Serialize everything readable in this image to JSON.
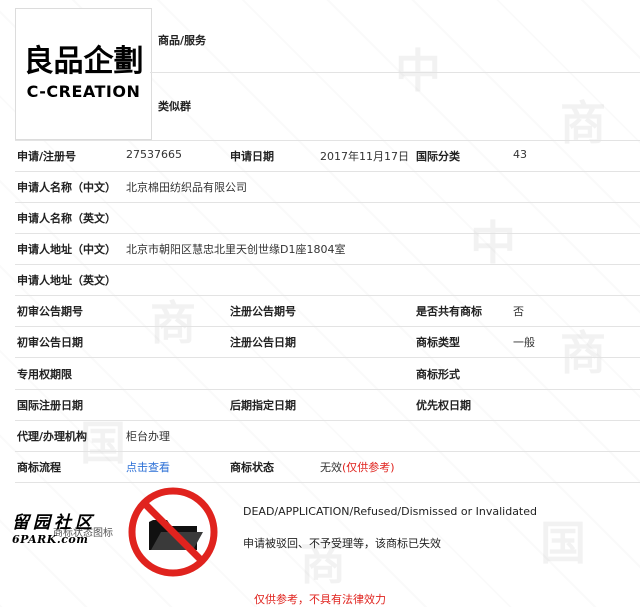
{
  "logo": {
    "cjk": "良品企劃",
    "en": "C-CREATION"
  },
  "header": {
    "goods_services_label": "商品/服务",
    "similar_group_label": "类似群"
  },
  "rows": {
    "reg_no_label": "申请/注册号",
    "reg_no_value": "27537665",
    "apply_date_label": "申请日期",
    "apply_date_value": "2017年11月17日",
    "intl_class_label": "国际分类",
    "intl_class_value": "43",
    "applicant_cn_label": "申请人名称（中文）",
    "applicant_cn_value": "北京棉田纺织品有限公司",
    "applicant_en_label": "申请人名称（英文）",
    "address_cn_label": "申请人地址（中文）",
    "address_cn_value": "北京市朝阳区慧忠北里天创世缘D1座1804室",
    "address_en_label": "申请人地址（英文）",
    "prelim_no_label": "初审公告期号",
    "reg_notice_no_label": "注册公告期号",
    "shared_label": "是否共有商标",
    "shared_value": "否",
    "prelim_date_label": "初审公告日期",
    "reg_notice_date_label": "注册公告日期",
    "type_label": "商标类型",
    "type_value": "一般",
    "exclusive_label": "专用权期限",
    "form_label": "商标形式",
    "intl_reg_date_label": "国际注册日期",
    "later_date_label": "后期指定日期",
    "priority_date_label": "优先权日期",
    "agent_label": "代理/办理机构",
    "agent_value": "柜台办理",
    "process_label": "商标流程",
    "process_link": "点击查看",
    "status_label": "商标状态",
    "status_value": "无效",
    "status_note": "(仅供参考)"
  },
  "status_block": {
    "status_image_label": "商标状态图标",
    "en_text": "DEAD/APPLICATION/Refused/Dismissed or Invalidated",
    "cn_text": "申请被驳回、不予受理等，该商标已失效"
  },
  "footer": "仅供参考，不具有法律效力",
  "side_watermark": {
    "top": "留园社区",
    "bottom": "6PARK.com"
  }
}
